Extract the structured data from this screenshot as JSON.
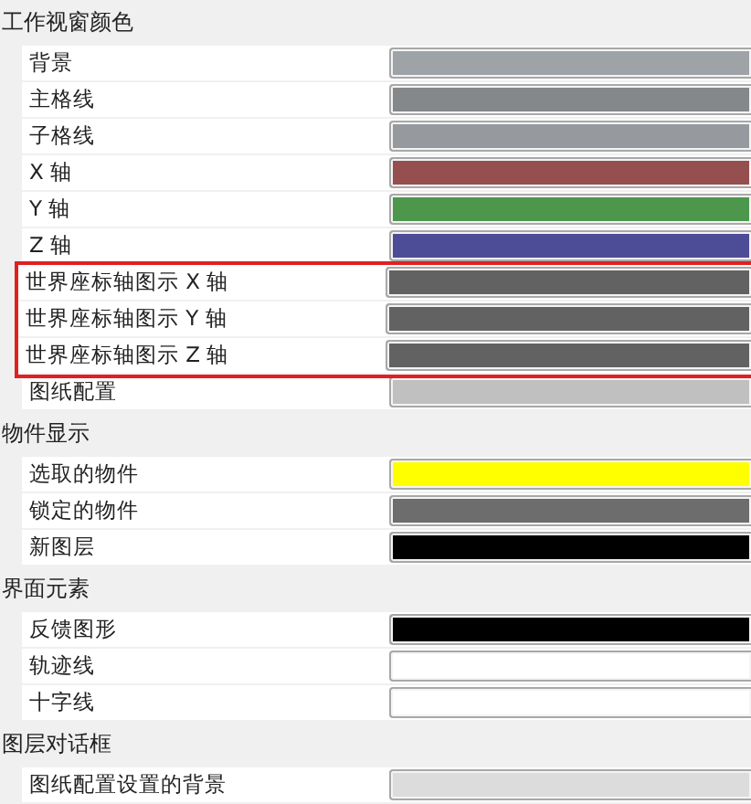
{
  "sections": [
    {
      "title": "工作视窗颜色",
      "items": [
        {
          "label": "背景",
          "color": "#9ea3a8",
          "highlighted": false
        },
        {
          "label": "主格线",
          "color": "#85888b",
          "highlighted": false
        },
        {
          "label": "子格线",
          "color": "#969a9f",
          "highlighted": false
        },
        {
          "label": "X 轴",
          "color": "#954f4f",
          "highlighted": false
        },
        {
          "label": "Y 轴",
          "color": "#4d974d",
          "highlighted": false
        },
        {
          "label": "Z 轴",
          "color": "#4d4d97",
          "highlighted": false
        },
        {
          "label": "世界座标轴图示 X 轴",
          "color": "#626262",
          "highlighted": true
        },
        {
          "label": "世界座标轴图示 Y 轴",
          "color": "#626262",
          "highlighted": true
        },
        {
          "label": "世界座标轴图示 Z 轴",
          "color": "#626262",
          "highlighted": true
        },
        {
          "label": "图纸配置",
          "color": "#c0c0c0",
          "highlighted": false
        }
      ]
    },
    {
      "title": "物件显示",
      "items": [
        {
          "label": "选取的物件",
          "color": "#ffff00",
          "highlighted": false
        },
        {
          "label": "锁定的物件",
          "color": "#6d6d6d",
          "highlighted": false
        },
        {
          "label": "新图层",
          "color": "#000000",
          "highlighted": false
        }
      ]
    },
    {
      "title": "界面元素",
      "items": [
        {
          "label": "反馈图形",
          "color": "#000000",
          "highlighted": false
        },
        {
          "label": "轨迹线",
          "color": "#ffffff",
          "highlighted": false
        },
        {
          "label": "十字线",
          "color": "#ffffff",
          "highlighted": false
        }
      ]
    },
    {
      "title": "图层对话框",
      "items": [
        {
          "label": "图纸配置设置的背景",
          "color": "#dcdcdc",
          "highlighted": false
        }
      ]
    }
  ]
}
